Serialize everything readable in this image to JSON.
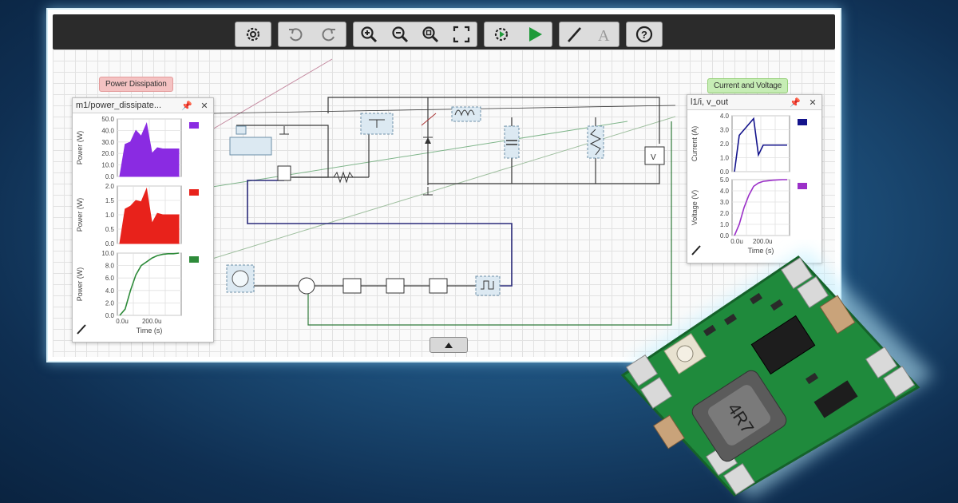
{
  "toolbar": {
    "groups": [
      {
        "items": [
          "gear-icon"
        ]
      },
      {
        "items": [
          "undo-icon",
          "redo-icon"
        ]
      },
      {
        "items": [
          "zoom-in-icon",
          "zoom-out-icon",
          "zoom-fit-icon",
          "fullscreen-icon"
        ]
      },
      {
        "items": [
          "sim-settings-icon",
          "play-icon"
        ]
      },
      {
        "items": [
          "pen-icon",
          "text-icon"
        ]
      },
      {
        "items": [
          "help-icon"
        ]
      }
    ]
  },
  "tags": {
    "power_dissipation": "Power Dissipation",
    "current_voltage": "Current and Voltage"
  },
  "left_panel": {
    "title": "m1/power_dissipate...",
    "pin": "📌",
    "close": "✕"
  },
  "right_panel": {
    "title": "l1/i, v_out",
    "pin": "📌",
    "close": "✕"
  },
  "colors": {
    "purple": "#8a2be2",
    "red": "#e8221b",
    "green": "#2e8b3a",
    "navy": "#14148c",
    "violet": "#9b30c8"
  },
  "chart_data": [
    {
      "type": "area",
      "ylabel": "Power (W)",
      "ylim": [
        0,
        50
      ],
      "yticks": [
        "50.0",
        "40.0",
        "30.0",
        "20.0",
        "10.0",
        "0.0"
      ],
      "series": [
        {
          "color": "#8a2be2",
          "values": [
            0,
            28,
            30,
            40,
            35,
            46,
            20,
            25,
            24,
            24,
            24,
            24
          ]
        }
      ]
    },
    {
      "type": "area",
      "ylabel": "Power (W)",
      "ylim": [
        0,
        2
      ],
      "yticks": [
        "2.0",
        "1.5",
        "1.0",
        "0.5",
        "0.0"
      ],
      "series": [
        {
          "color": "#e8221b",
          "values": [
            0,
            1.2,
            1.3,
            1.5,
            1.45,
            1.9,
            0.7,
            1.05,
            1.0,
            1.0,
            1.0,
            1.0
          ]
        }
      ]
    },
    {
      "type": "line",
      "ylabel": "Power (W)",
      "xlabel": "Time (s)",
      "ylim": [
        0,
        10
      ],
      "yticks": [
        "10.0",
        "8.0",
        "6.0",
        "4.0",
        "2.0",
        "0.0"
      ],
      "xticks": [
        "0.0u",
        "200.0u"
      ],
      "series": [
        {
          "color": "#2e8b3a",
          "values": [
            0,
            1,
            4,
            6.5,
            8,
            8.6,
            9.2,
            9.6,
            9.8,
            9.9,
            9.9,
            10
          ]
        }
      ]
    },
    {
      "type": "line",
      "ylabel": "Current (A)",
      "ylim": [
        0,
        4
      ],
      "yticks": [
        "4.0",
        "3.0",
        "2.0",
        "1.0",
        "0.0"
      ],
      "series": [
        {
          "color": "#14148c",
          "values": [
            0,
            2.6,
            3.0,
            3.4,
            3.8,
            1.2,
            1.9,
            1.9,
            1.9,
            1.9,
            1.9,
            1.9
          ]
        }
      ]
    },
    {
      "type": "line",
      "ylabel": "Voltage (V)",
      "xlabel": "Time (s)",
      "ylim": [
        0,
        5
      ],
      "yticks": [
        "5.0",
        "4.0",
        "3.0",
        "2.0",
        "1.0",
        "0.0"
      ],
      "xticks": [
        "0.0u",
        "200.0u"
      ],
      "series": [
        {
          "color": "#9b30c8",
          "values": [
            0,
            1.0,
            2.5,
            3.6,
            4.4,
            4.7,
            4.85,
            4.9,
            4.95,
            4.98,
            5.0,
            5.0
          ]
        }
      ]
    }
  ]
}
